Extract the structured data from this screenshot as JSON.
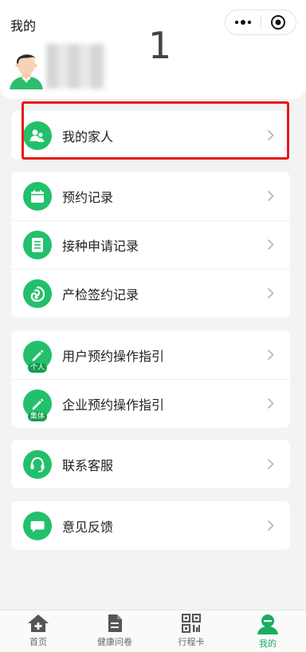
{
  "header": {
    "title": "我的",
    "annotation_number": "1",
    "capsule": {
      "more_icon": "more-dots-icon",
      "close_icon": "target-close-icon"
    }
  },
  "menu": {
    "family": {
      "label": "我的家人",
      "icon": "family-icon"
    },
    "appointment_records": {
      "label": "预约记录",
      "icon": "calendar-icon"
    },
    "vaccination_records": {
      "label": "接种申请记录",
      "icon": "document-icon"
    },
    "prenatal_records": {
      "label": "产检签约记录",
      "icon": "baby-icon"
    },
    "personal_guide": {
      "label": "用户预约操作指引",
      "icon": "pen-icon",
      "badge": "个人"
    },
    "company_guide": {
      "label": "企业预约操作指引",
      "icon": "pen-icon",
      "badge": "集体"
    },
    "customer_service": {
      "label": "联系客服",
      "icon": "headset-icon"
    },
    "feedback": {
      "label": "意见反馈",
      "icon": "chat-bubble-icon"
    }
  },
  "tabbar": {
    "tabs": [
      {
        "label": "首页",
        "icon": "home-icon"
      },
      {
        "label": "健康问卷",
        "icon": "questionnaire-icon"
      },
      {
        "label": "行程卡",
        "icon": "qrcode-icon"
      },
      {
        "label": "我的",
        "icon": "profile-icon",
        "active": true
      }
    ]
  },
  "colors": {
    "accent": "#22c06b",
    "active_tab": "#1aad5f",
    "highlight": "#e8171b"
  }
}
